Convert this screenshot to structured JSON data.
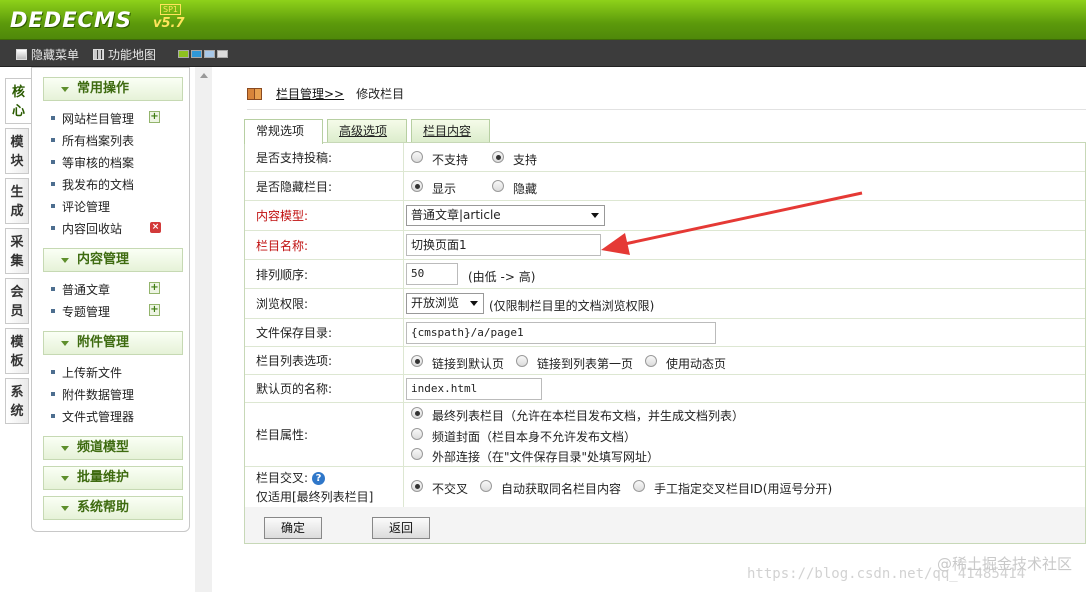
{
  "header": {
    "logo": "DEDECMS",
    "version": "v5.7",
    "sp_badge": "SP1"
  },
  "subbar": {
    "hide_menu": "隐藏菜单",
    "site_map": "功能地图",
    "skin_colors": [
      "#8dc21f",
      "#2f98d8",
      "#a8c8e8",
      "#dddddd"
    ]
  },
  "vertical_tabs": [
    "核心",
    "模块",
    "生成",
    "采集",
    "会员",
    "模板",
    "系统"
  ],
  "menu": {
    "sections": [
      {
        "title": "常用操作",
        "items": [
          "网站栏目管理",
          "所有档案列表",
          "等审核的档案",
          "我发布的文档",
          "评论管理",
          "内容回收站"
        ]
      },
      {
        "title": "内容管理",
        "items": [
          "普通文章",
          "专题管理"
        ]
      },
      {
        "title": "附件管理",
        "items": [
          "上传新文件",
          "附件数据管理",
          "文件式管理器"
        ]
      },
      {
        "title": "频道模型",
        "items": []
      },
      {
        "title": "批量维护",
        "items": []
      },
      {
        "title": "系统帮助",
        "items": []
      }
    ]
  },
  "breadcrumb": {
    "link": "栏目管理>>",
    "current": "修改栏目"
  },
  "tabs": [
    "常规选项",
    "高级选项",
    "栏目内容"
  ],
  "form": {
    "submit_label": {
      "label": "是否支持投稿:",
      "options": [
        "不支持",
        "支持"
      ],
      "selected": "支持"
    },
    "hidden": {
      "label": "是否隐藏栏目:",
      "options": [
        "显示",
        "隐藏"
      ],
      "selected": "显示"
    },
    "model": {
      "label": "内容模型:",
      "value": "普通文章|article"
    },
    "name": {
      "label": "栏目名称:",
      "value": "切换页面1"
    },
    "order": {
      "label": "排列顺序:",
      "value": "50",
      "hint": "(由低 -> 高)"
    },
    "perm": {
      "label": "浏览权限:",
      "value": "开放浏览",
      "hint": "(仅限制栏目里的文档浏览权限)"
    },
    "dir": {
      "label": "文件保存目录:",
      "value": "{cmspath}/a/page1"
    },
    "list_opt": {
      "label": "栏目列表选项:",
      "options": [
        "链接到默认页",
        "链接到列表第一页",
        "使用动态页"
      ],
      "selected": "链接到默认页"
    },
    "default_page": {
      "label": "默认页的名称:",
      "value": "index.html"
    },
    "attr": {
      "label": "栏目属性:",
      "options": [
        "最终列表栏目（允许在本栏目发布文档，并生成文档列表）",
        "频道封面（栏目本身不允许发布文档）",
        "外部连接（在\"文件保存目录\"处填写网址）"
      ],
      "selected": "最终列表栏目（允许在本栏目发布文档，并生成文档列表）"
    },
    "cross": {
      "label": "栏目交叉:",
      "sublabel": "仅适用[最终列表栏目]",
      "options": [
        "不交叉",
        "自动获取同名栏目内容",
        "手工指定交叉栏目ID(用逗号分开)"
      ],
      "selected": "不交叉"
    },
    "ok_button": "确定",
    "back_button": "返回"
  },
  "watermark": {
    "brand": "@稀土掘金技术社区",
    "url": "https://blog.csdn.net/qq_41485414"
  },
  "accent_colors": {
    "top_green": "#5c9a0b",
    "label_red": "#c01010",
    "annotation_arrow": "#e53935"
  }
}
